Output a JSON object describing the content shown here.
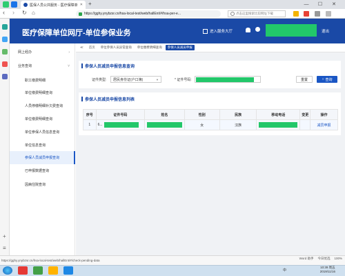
{
  "browser": {
    "tab_title": "医保人员公共服务 - 医疗保障单位",
    "url": "https://gghy.ynybzsr.cn/hsa-local-test/web/hallEnt/#/hsa-per-e...",
    "search_placeholder": "点击这里搜索比较网址下载",
    "minimize": "—",
    "maximize": "☐",
    "close": "✕",
    "back": "‹",
    "forward": "›",
    "reload": "↻",
    "home": "⌂",
    "new_tab": "+"
  },
  "header": {
    "title": "医疗保障单位网厅-单位参保业务",
    "hall_label": "进入服务大厅",
    "logout": "退出"
  },
  "nav": {
    "items": [
      {
        "label": "网上经办",
        "chevron": "›"
      },
      {
        "label": "业务查询",
        "chevron": "˅"
      },
      {
        "label": "职工缴费明细"
      },
      {
        "label": "单位缴费明细查询"
      },
      {
        "label": "人员停缴明细补欠费查询"
      },
      {
        "label": "单位缴费明细查询"
      },
      {
        "label": "单位参保人员信息查询"
      },
      {
        "label": "单位信息查询"
      },
      {
        "label": "参保人员减员申报查询"
      },
      {
        "label": "已申报数据查询"
      },
      {
        "label": "因病住院查询"
      }
    ],
    "active_index": 8
  },
  "breadcrumbs": [
    "首页",
    "单位参保人员异常查询",
    "单位缴费明细查询",
    "参保人员减员申报"
  ],
  "query": {
    "title": "参保人员减员申报信息查询",
    "id_type_label": "证件类型:",
    "id_type_value": "居民身份证(户口簿)",
    "id_no_label": "* 证件号码:",
    "reset": "重置",
    "search": "查询"
  },
  "list": {
    "title": "参保人员减员申报信息列表",
    "columns": [
      "序号",
      "证件号码",
      "姓名",
      "性别",
      "民族",
      "移动电话",
      "变更",
      "操作"
    ],
    "rows": [
      {
        "index": "1",
        "id_prefix": "6...",
        "gender": "女",
        "ethnicity": "汉族",
        "action": "减员申报"
      }
    ]
  },
  "status": {
    "url": "https://gghy.ynybzsr.cn/hsa-local-test/web/hallEnt/#/check-pending-data",
    "items": [
      "Word 助手",
      "今日优选",
      "100%"
    ]
  },
  "taskbar": {
    "time": "10:39 周五",
    "date": "2019/11/16",
    "lang": "中"
  },
  "colors": {
    "brand": "#1a49a6",
    "link": "#1a56c4",
    "redaction": "#22c76a"
  }
}
